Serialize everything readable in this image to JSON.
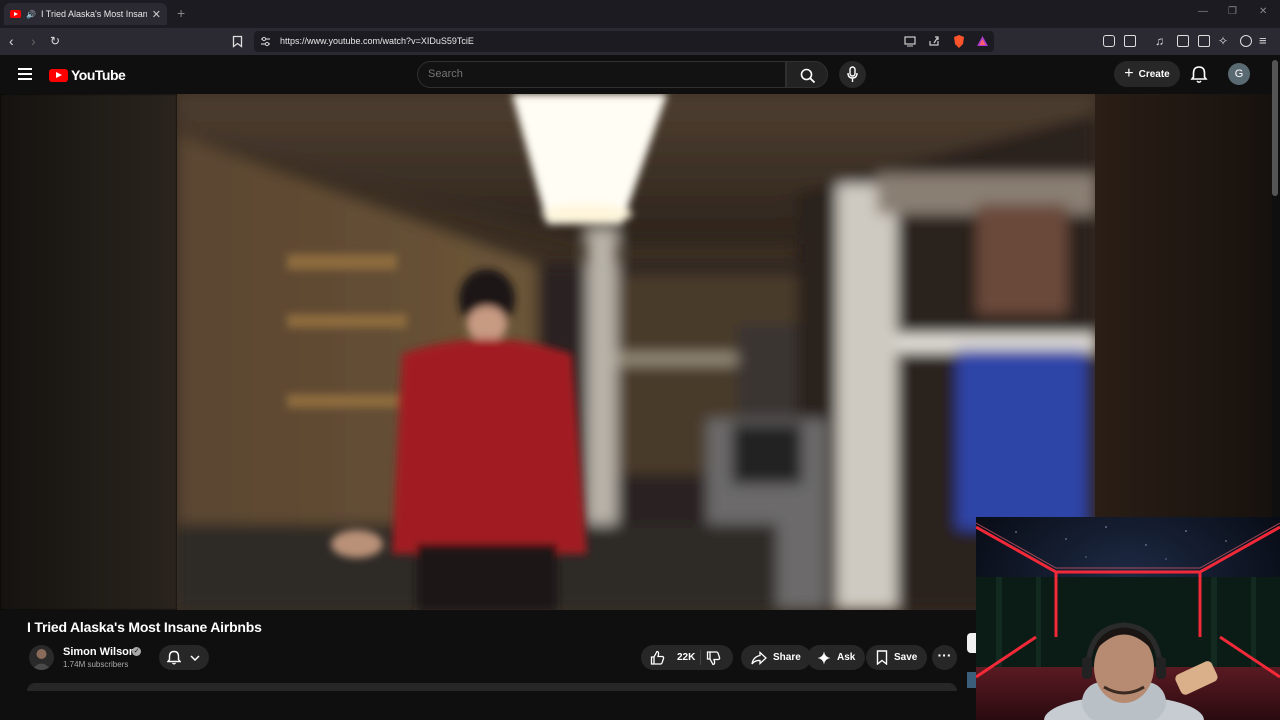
{
  "browser": {
    "tab_title": "I Tried Alaska's Most Insane A",
    "tab_audio_icon": "speaker-icon",
    "new_tab_label": "+",
    "url": "https://www.youtube.com/watch?v=XIDuS59TciE",
    "window_controls": [
      "—",
      "❐",
      "✕"
    ]
  },
  "youtube": {
    "logo_text": "YouTube",
    "search_placeholder": "Search",
    "create_label": "Create",
    "avatar_letter": "G"
  },
  "video": {
    "title": "I Tried Alaska's Most Insane Airbnbs",
    "channel_name": "Simon Wilson",
    "subscribers": "1.74M subscribers",
    "likes": "22K",
    "share_label": "Share",
    "ask_label": "Ask",
    "save_label": "Save"
  },
  "colors": {
    "youtube_red": "#ff0000",
    "background": "#0f0f0f",
    "button_bg": "#272727"
  }
}
